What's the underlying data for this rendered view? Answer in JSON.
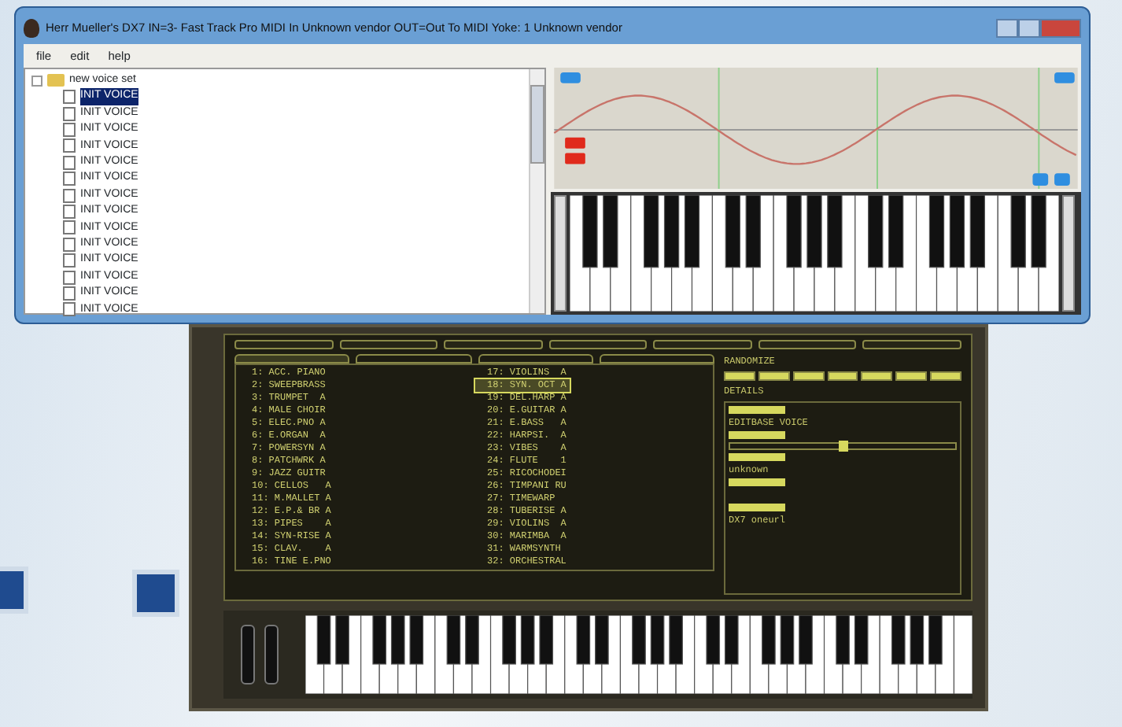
{
  "window": {
    "title": "Herr Mueller's DX7 IN=3- Fast Track Pro MIDI In Unknown vendor OUT=Out To MIDI Yoke:  1 Unknown vendor"
  },
  "menu": [
    {
      "label": "file"
    },
    {
      "label": "edit"
    },
    {
      "label": "help"
    }
  ],
  "tree": {
    "label": "new voice set",
    "expanded": true,
    "children": [
      {
        "label": "INIT VOICE",
        "selected": true
      },
      {
        "label": "INIT VOICE",
        "selected": false
      },
      {
        "label": "INIT VOICE",
        "selected": false
      },
      {
        "label": "INIT VOICE",
        "selected": false
      },
      {
        "label": "INIT VOICE",
        "selected": false
      },
      {
        "label": "INIT VOICE",
        "selected": false
      },
      {
        "label": "INIT VOICE",
        "selected": false
      },
      {
        "label": "INIT VOICE",
        "selected": false
      },
      {
        "label": "INIT VOICE",
        "selected": false
      },
      {
        "label": "INIT VOICE",
        "selected": false
      },
      {
        "label": "INIT VOICE",
        "selected": false
      },
      {
        "label": "INIT VOICE",
        "selected": false
      },
      {
        "label": "INIT VOICE",
        "selected": false
      },
      {
        "label": "INIT VOICE",
        "selected": false
      }
    ]
  },
  "banks": [
    {
      "selected": true
    },
    {
      "selected": false
    },
    {
      "selected": false
    },
    {
      "selected": false
    }
  ],
  "voices": [
    {
      "number": "1:",
      "name": "ACC. PIANO",
      "selected": false
    },
    {
      "number": "2:",
      "name": "SWEEPBRASS",
      "selected": false
    },
    {
      "number": "3:",
      "name": "TRUMPET  A",
      "selected": false
    },
    {
      "number": "4:",
      "name": "MALE CHOIR",
      "selected": false
    },
    {
      "number": "5:",
      "name": "ELEC.PNO A",
      "selected": false
    },
    {
      "number": "6:",
      "name": "E.ORGAN  A",
      "selected": false
    },
    {
      "number": "7:",
      "name": "POWERSYN A",
      "selected": false
    },
    {
      "number": "8:",
      "name": "PATCHWRK A",
      "selected": false
    },
    {
      "number": "9:",
      "name": "JAZZ GUITR",
      "selected": false
    },
    {
      "number": "10:",
      "name": "CELLOS   A",
      "selected": false
    },
    {
      "number": "11:",
      "name": "M.MALLET A",
      "selected": false
    },
    {
      "number": "12:",
      "name": "E.P.& BR A",
      "selected": false
    },
    {
      "number": "13:",
      "name": "PIPES    A",
      "selected": false
    },
    {
      "number": "14:",
      "name": "SYN-RISE A",
      "selected": false
    },
    {
      "number": "15:",
      "name": "CLAV.    A",
      "selected": false
    },
    {
      "number": "16:",
      "name": "TINE E.PNO",
      "selected": false
    },
    {
      "number": "17:",
      "name": "VIOLINS  A",
      "selected": false
    },
    {
      "number": "18:",
      "name": "SYN. OCT A",
      "selected": true
    },
    {
      "number": "19:",
      "name": "DEL.HARP A",
      "selected": false
    },
    {
      "number": "20:",
      "name": "E.GUITAR A",
      "selected": false
    },
    {
      "number": "21:",
      "name": "E.BASS   A",
      "selected": false
    },
    {
      "number": "22:",
      "name": "HARPSI.  A",
      "selected": false
    },
    {
      "number": "23:",
      "name": "VIBES    A",
      "selected": false
    },
    {
      "number": "24:",
      "name": "FLUTE    1",
      "selected": false
    },
    {
      "number": "25:",
      "name": "RICOCHODEI",
      "selected": false
    },
    {
      "number": "26:",
      "name": "TIMPANI RU",
      "selected": false
    },
    {
      "number": "27:",
      "name": "TIMEWARP",
      "selected": false
    },
    {
      "number": "28:",
      "name": "TUBERISE A",
      "selected": false
    },
    {
      "number": "29:",
      "name": "VIOLINS  A",
      "selected": false
    },
    {
      "number": "30:",
      "name": "MARIMBA  A",
      "selected": false
    },
    {
      "number": "31:",
      "name": "WARMSYNTH",
      "selected": false
    },
    {
      "number": "32:",
      "name": "ORCHESTRAL",
      "selected": false
    }
  ],
  "randomize": {
    "title": "RANDOMIZE",
    "toggles": [
      {
        "on": true
      },
      {
        "on": true
      },
      {
        "on": true
      },
      {
        "on": true
      },
      {
        "on": true
      },
      {
        "on": true
      },
      {
        "on": true
      }
    ]
  },
  "details": {
    "title": "DETAILS",
    "fields": [
      {
        "value": "EDITBASE VOICE"
      },
      {
        "kind": "slider",
        "level": 0.5
      },
      {
        "value": "unknown"
      },
      {
        "kind": "label_only"
      },
      {
        "value": "DX7 oneurl"
      }
    ]
  }
}
